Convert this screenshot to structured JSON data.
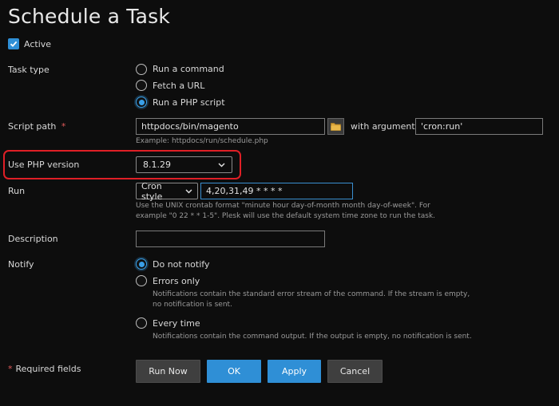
{
  "title": "Schedule a Task",
  "active": {
    "label": "Active",
    "checked": true
  },
  "task_type": {
    "label": "Task type",
    "options": [
      "Run a command",
      "Fetch a URL",
      "Run a PHP script"
    ],
    "selected": 2
  },
  "script_path": {
    "label": "Script path",
    "required_mark": "*",
    "value": "httpdocs/bin/magento",
    "example": "Example: httpdocs/run/schedule.php",
    "args_label": "with arguments",
    "args_value": "'cron:run'"
  },
  "php_version": {
    "label": "Use PHP version",
    "value": "8.1.29"
  },
  "run": {
    "label": "Run",
    "mode": "Cron style",
    "value": "4,20,31,49 * * * *",
    "hint_line1": "Use the UNIX crontab format \"minute hour day-of-month month day-of-week\". For",
    "hint_line2": "example \"0 22 * * 1-5\". Plesk will use the default system time zone to run the task."
  },
  "description": {
    "label": "Description",
    "value": ""
  },
  "notify": {
    "label": "Notify",
    "options": [
      {
        "label": "Do not notify"
      },
      {
        "label": "Errors only",
        "hint_line1": "Notifications contain the standard error stream of the command. If the stream is empty,",
        "hint_line2": "no notification is sent."
      },
      {
        "label": "Every time",
        "hint_line1": "Notifications contain the command output. If the output is empty, no notification is sent."
      }
    ],
    "selected": 0
  },
  "required_note": {
    "mark": "*",
    "text": "Required fields"
  },
  "buttons": {
    "run_now": "Run Now",
    "ok": "OK",
    "apply": "Apply",
    "cancel": "Cancel"
  },
  "colors": {
    "accent": "#2f8fd6",
    "highlight": "#e01f26",
    "required": "#e05a5a"
  },
  "icons": {
    "checkbox": "check-icon",
    "folder": "folder-icon",
    "dropdown": "chevron-down-icon"
  }
}
